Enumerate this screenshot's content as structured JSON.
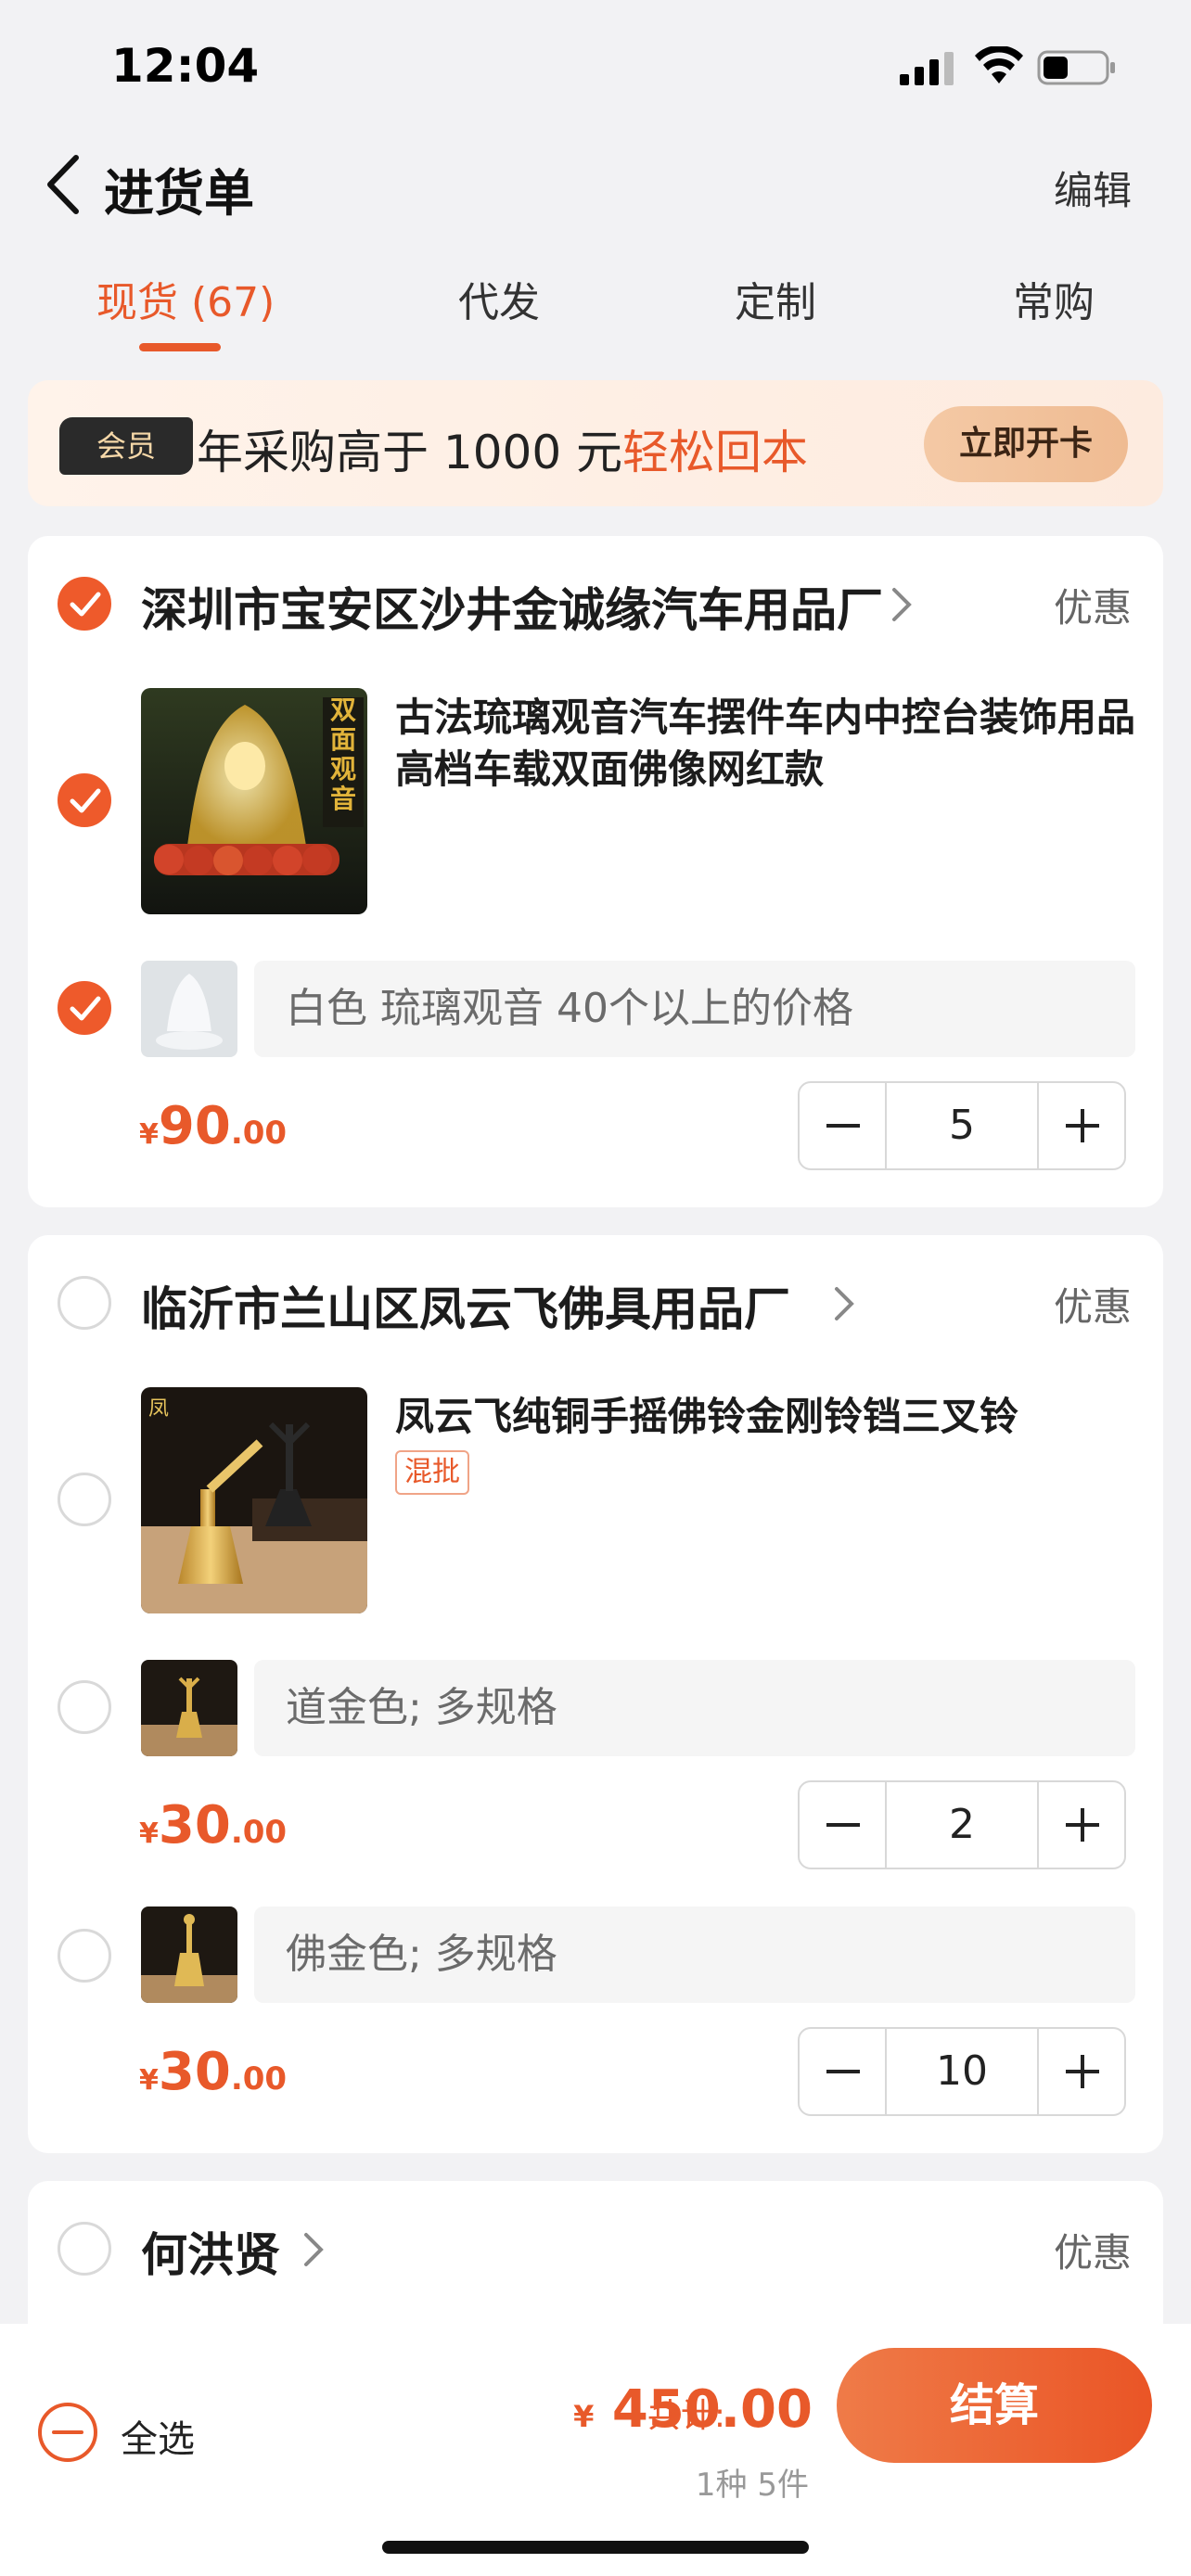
{
  "status_bar": {
    "time": "12:04"
  },
  "nav": {
    "title": "进货单",
    "edit_label": "编辑"
  },
  "tabs": [
    {
      "label": "现货 (67)",
      "active": true
    },
    {
      "label": "代发",
      "active": false
    },
    {
      "label": "定制",
      "active": false
    },
    {
      "label": "常购",
      "active": false
    }
  ],
  "member_banner": {
    "badge": "会员",
    "text_prefix": "年采购高于 1000 元",
    "text_highlight": "轻松回本",
    "button_label": "立即开卡"
  },
  "shops": [
    {
      "name": "深圳市宝安区沙井金诚缘汽车用品厂",
      "promo_label": "优惠",
      "checked": true,
      "product": {
        "title": "古法琉璃观音汽车摆件车内中控台装饰用品高档车载双面佛像网红款",
        "image_overlay_text": "双面观音",
        "checked": true
      },
      "skus": [
        {
          "spec": "白色 琉璃观音 40个以上的价格",
          "price_currency": "¥",
          "price_int": "90",
          "price_dec": ".00",
          "quantity": "5",
          "checked": true
        }
      ]
    },
    {
      "name": "临沂市兰山区凤云飞佛具用品厂",
      "promo_label": "优惠",
      "checked": false,
      "product": {
        "title": "凤云飞纯铜手摇佛铃金刚铃铛三叉铃",
        "tag": "混批",
        "checked": false
      },
      "skus": [
        {
          "spec": "道金色; 多规格",
          "price_currency": "¥",
          "price_int": "30",
          "price_dec": ".00",
          "quantity": "2",
          "checked": false
        },
        {
          "spec": "佛金色; 多规格",
          "price_currency": "¥",
          "price_int": "30",
          "price_dec": ".00",
          "quantity": "10",
          "checked": false
        }
      ]
    },
    {
      "name": "何洪贤",
      "promo_label": "优惠",
      "checked": false
    }
  ],
  "bottom_bar": {
    "select_all_label": "全选",
    "total_label": "共计:",
    "total_currency": "¥",
    "total_amount": "450.00",
    "item_count": "1种 5件",
    "checkout_label": "结算"
  },
  "colors": {
    "accent": "#e8592a",
    "background": "#f2f2f4",
    "card": "#ffffff"
  }
}
